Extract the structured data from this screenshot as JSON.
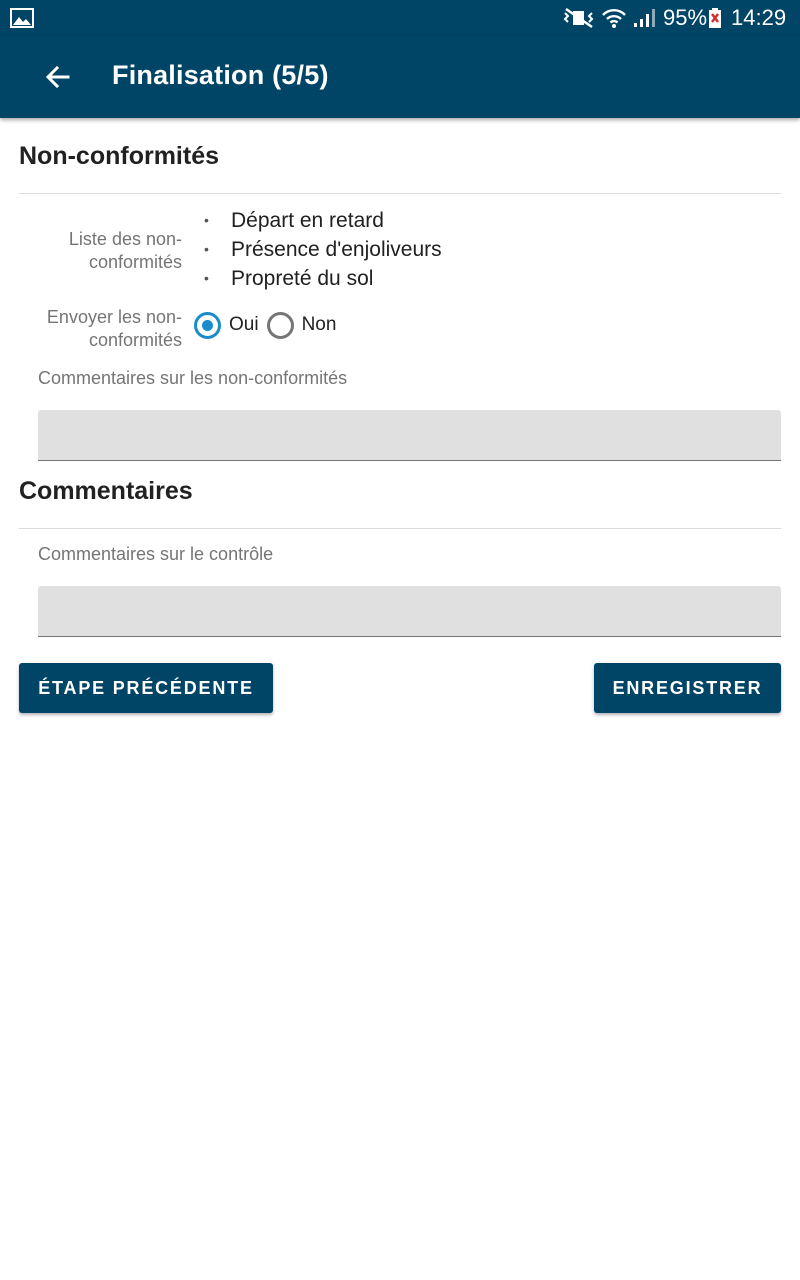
{
  "status_bar": {
    "battery_percent": "95%",
    "time": "14:29"
  },
  "app_bar": {
    "title": "Finalisation (5/5)"
  },
  "nonconformities": {
    "section_title": "Non-conformités",
    "list_label": "Liste des non-conformités",
    "items": [
      "Départ en retard",
      "Présence d'enjoliveurs",
      "Propreté du sol"
    ],
    "send_label": "Envoyer les non-conformités",
    "send_options": [
      {
        "label": "Oui",
        "selected": true
      },
      {
        "label": "Non",
        "selected": false
      }
    ],
    "comment_caption": "Commentaires sur les non-conformités",
    "comment_value": ""
  },
  "comments": {
    "section_title": "Commentaires",
    "comment_caption": "Commentaires sur le contrôle",
    "comment_value": ""
  },
  "actions": {
    "previous_label": "ÉTAPE PRÉCÉDENTE",
    "save_label": "ENREGISTRER"
  },
  "colors": {
    "primary": "#004466",
    "radio_accent": "#1a8ccc"
  }
}
